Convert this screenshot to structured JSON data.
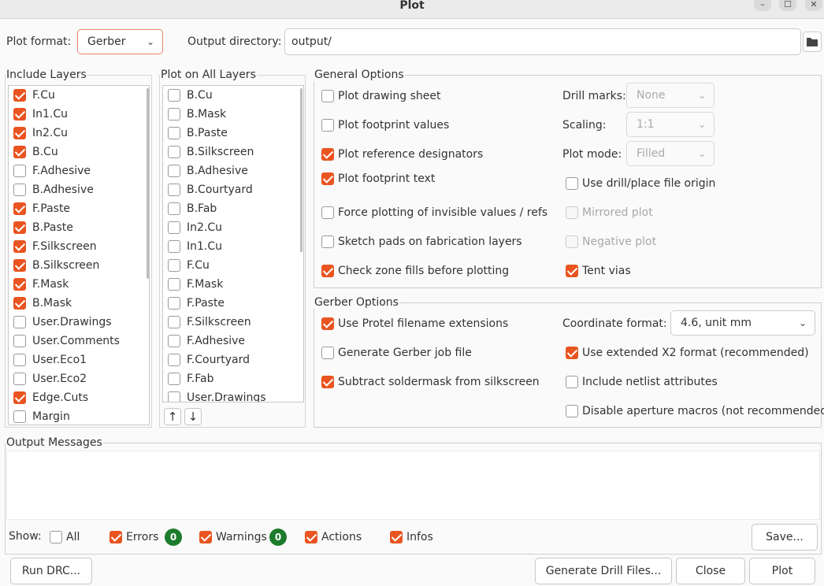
{
  "window": {
    "title": "Plot",
    "minimize": "–",
    "maximize": "☐",
    "close": "✕"
  },
  "top": {
    "plot_format_label": "Plot format:",
    "plot_format_value": "Gerber",
    "output_dir_label": "Output directory:",
    "output_dir_value": "output/"
  },
  "include_layers": {
    "title": "Include Layers",
    "items": [
      {
        "label": "F.Cu",
        "checked": true
      },
      {
        "label": "In1.Cu",
        "checked": true
      },
      {
        "label": "In2.Cu",
        "checked": true
      },
      {
        "label": "B.Cu",
        "checked": true
      },
      {
        "label": "F.Adhesive",
        "checked": false
      },
      {
        "label": "B.Adhesive",
        "checked": false
      },
      {
        "label": "F.Paste",
        "checked": true
      },
      {
        "label": "B.Paste",
        "checked": true
      },
      {
        "label": "F.Silkscreen",
        "checked": true
      },
      {
        "label": "B.Silkscreen",
        "checked": true
      },
      {
        "label": "F.Mask",
        "checked": true
      },
      {
        "label": "B.Mask",
        "checked": true
      },
      {
        "label": "User.Drawings",
        "checked": false
      },
      {
        "label": "User.Comments",
        "checked": false
      },
      {
        "label": "User.Eco1",
        "checked": false
      },
      {
        "label": "User.Eco2",
        "checked": false
      },
      {
        "label": "Edge.Cuts",
        "checked": true
      },
      {
        "label": "Margin",
        "checked": false
      }
    ]
  },
  "plot_all_layers": {
    "title": "Plot on All Layers",
    "items": [
      {
        "label": "B.Cu",
        "checked": false
      },
      {
        "label": "B.Mask",
        "checked": false
      },
      {
        "label": "B.Paste",
        "checked": false
      },
      {
        "label": "B.Silkscreen",
        "checked": false
      },
      {
        "label": "B.Adhesive",
        "checked": false
      },
      {
        "label": "B.Courtyard",
        "checked": false
      },
      {
        "label": "B.Fab",
        "checked": false
      },
      {
        "label": "In2.Cu",
        "checked": false
      },
      {
        "label": "In1.Cu",
        "checked": false
      },
      {
        "label": "F.Cu",
        "checked": false
      },
      {
        "label": "F.Mask",
        "checked": false
      },
      {
        "label": "F.Paste",
        "checked": false
      },
      {
        "label": "F.Silkscreen",
        "checked": false
      },
      {
        "label": "F.Adhesive",
        "checked": false
      },
      {
        "label": "F.Courtyard",
        "checked": false
      },
      {
        "label": "F.Fab",
        "checked": false
      },
      {
        "label": "User.Drawings",
        "checked": false
      }
    ],
    "up_icon": "arrow-up-icon",
    "down_icon": "arrow-down-icon"
  },
  "general": {
    "title": "General Options",
    "plot_drawing_sheet": {
      "label": "Plot drawing sheet",
      "checked": false
    },
    "plot_footprint_values": {
      "label": "Plot footprint values",
      "checked": false
    },
    "plot_reference_designators": {
      "label": "Plot reference designators",
      "checked": true
    },
    "plot_footprint_text": {
      "label": "Plot footprint text",
      "checked": true
    },
    "force_invisible": {
      "label": "Force plotting of invisible values / refs",
      "checked": false
    },
    "sketch_pads": {
      "label": "Sketch pads on fabrication layers",
      "checked": false
    },
    "check_zone_fills": {
      "label": "Check zone fills before plotting",
      "checked": true
    },
    "drill_marks_label": "Drill marks:",
    "drill_marks_value": "None",
    "scaling_label": "Scaling:",
    "scaling_value": "1:1",
    "plot_mode_label": "Plot mode:",
    "plot_mode_value": "Filled",
    "use_drill_origin": {
      "label": "Use drill/place file origin",
      "checked": false
    },
    "mirrored_plot": {
      "label": "Mirrored plot",
      "checked": false
    },
    "negative_plot": {
      "label": "Negative plot",
      "checked": false
    },
    "tent_vias": {
      "label": "Tent vias",
      "checked": true
    }
  },
  "gerber": {
    "title": "Gerber Options",
    "protel_ext": {
      "label": "Use Protel filename extensions",
      "checked": true
    },
    "gen_job_file": {
      "label": "Generate Gerber job file",
      "checked": false
    },
    "subtract_mask": {
      "label": "Subtract soldermask from silkscreen",
      "checked": true
    },
    "coord_format_label": "Coordinate format:",
    "coord_format_value": "4.6, unit mm",
    "x2_format": {
      "label": "Use extended X2 format (recommended)",
      "checked": true
    },
    "netlist_attrs": {
      "label": "Include netlist attributes",
      "checked": false
    },
    "disable_aperture_macros": {
      "label": "Disable aperture macros (not recommended)",
      "checked": false
    }
  },
  "messages": {
    "title": "Output Messages",
    "show_label": "Show:",
    "all": {
      "label": "All",
      "checked": false
    },
    "errors": {
      "label": "Errors",
      "checked": true,
      "count": "0"
    },
    "warnings": {
      "label": "Warnings",
      "checked": true,
      "count": "0"
    },
    "actions": {
      "label": "Actions",
      "checked": true
    },
    "infos": {
      "label": "Infos",
      "checked": true
    },
    "save_label": "Save..."
  },
  "buttons": {
    "run_drc": "Run DRC...",
    "gen_drill": "Generate Drill Files...",
    "close": "Close",
    "plot": "Plot"
  },
  "colors": {
    "accent": "#e95420",
    "badge": "#1c7c2c"
  }
}
